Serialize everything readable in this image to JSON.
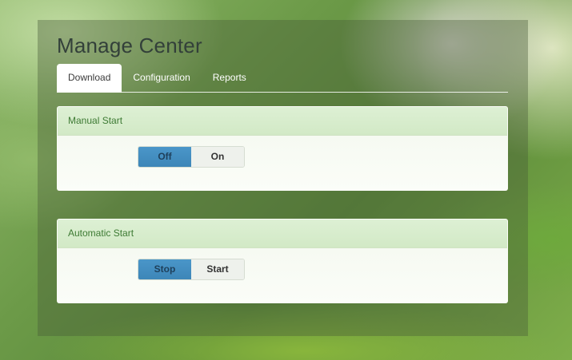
{
  "page_title": "Manage Center",
  "tabs": [
    {
      "label": "Download",
      "active": true
    },
    {
      "label": "Configuration",
      "active": false
    },
    {
      "label": "Reports",
      "active": false
    }
  ],
  "manual_start": {
    "title": "Manual Start",
    "options": [
      "Off",
      "On"
    ],
    "selected": "Off"
  },
  "automatic_start": {
    "title": "Automatic Start",
    "options": [
      "Stop",
      "Start"
    ],
    "selected": "Stop"
  },
  "colors": {
    "selected_toggle": "#4a96c9",
    "card_header_bg": "#ddf0d4",
    "card_header_text": "#3d7a33"
  }
}
